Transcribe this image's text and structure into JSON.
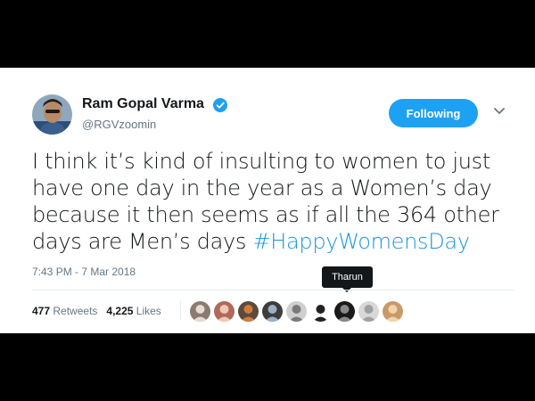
{
  "tweet": {
    "author_name": "Ram Gopal Varma",
    "author_handle": "@RGVzoomin",
    "follow_label": "Following",
    "text": "I think it’s kind of insulting to women to just have one day in the year as a Women’s day because it then seems as if all the 364 other days are Men’s days ",
    "hashtag": "#HappyWomensDay",
    "timestamp": "7:43 PM - 7 Mar 2018",
    "retweets_count": "477",
    "retweets_label": "Retweets",
    "likes_count": "4,225",
    "likes_label": "Likes",
    "tooltip": "Tharun"
  },
  "colors": {
    "accent": "#1da1f2",
    "hashtag": "#1b95e0",
    "muted": "#657786",
    "text": "#14171a"
  },
  "icons": [
    "verified-icon",
    "chevron-down-icon"
  ],
  "liker_avatars": [
    {
      "id": "liker-1",
      "bg": "#8a7a70",
      "fg": "#e6dcd2"
    },
    {
      "id": "liker-2",
      "bg": "#b06a5a",
      "fg": "#f0c8b4"
    },
    {
      "id": "liker-3",
      "bg": "#5c4a3c",
      "fg": "#d47a3a"
    },
    {
      "id": "liker-4",
      "bg": "#3d3d3d",
      "fg": "#9cb0c4"
    },
    {
      "id": "liker-5",
      "bg": "#cfcfcf",
      "fg": "#7a7a7a"
    },
    {
      "id": "liker-6",
      "bg": "#ffffff",
      "fg": "#222222"
    },
    {
      "id": "liker-7",
      "bg": "#1a1a1a",
      "fg": "#888888"
    },
    {
      "id": "liker-8",
      "bg": "#d8d8d8",
      "fg": "#a0a0a0"
    },
    {
      "id": "liker-9",
      "bg": "#c89a6a",
      "fg": "#f2d4a8"
    }
  ]
}
